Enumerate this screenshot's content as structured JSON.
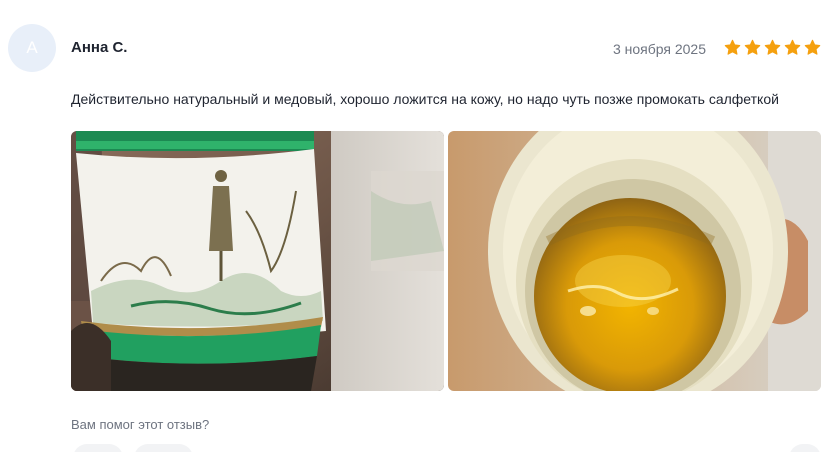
{
  "review": {
    "avatar_initial": "А",
    "author": "Анна С.",
    "date": "3 ноября 2025",
    "rating": 5,
    "rating_max": 5,
    "star_color": "#f5a00f",
    "text": "Действительно натуральный и медовый, хорошо ложится на кожу, но надо чуть позже промокать салфеткой",
    "photos": [
      {
        "subject": "jar-side-view"
      },
      {
        "subject": "jar-open-top-view"
      }
    ],
    "helpful_question": "Вам помог этот отзыв?"
  }
}
